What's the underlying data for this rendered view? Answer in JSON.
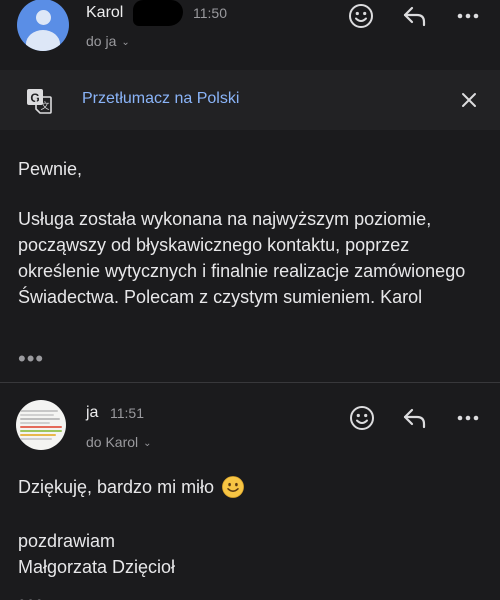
{
  "message1": {
    "sender": "Karol",
    "time": "11:50",
    "recipient": "do ja"
  },
  "translate": {
    "label": "Przetłumacz na Polski"
  },
  "body1": {
    "greeting": "Pewnie,",
    "paragraph": "Usługa została wykonana na najwyższym poziomie, począwszy od błyskawicznego kontaktu, poprzez określenie wytycznych i finalnie realizacje zamówionego Świadectwa. Polecam z czystym sumieniem. Karol",
    "more": "•••"
  },
  "message2": {
    "sender": "ja",
    "time": "11:51",
    "recipient": "do Karol"
  },
  "body2": {
    "thanks": "Dziękuję, bardzo mi miło",
    "regards": "pozdrawiam",
    "signature": "Małgorzata Dzięcioł",
    "more": "•••"
  },
  "icons": {
    "emoji": "emoji-reaction-icon",
    "reply": "reply-icon",
    "more": "more-options-icon",
    "translate": "translate-icon",
    "close": "close-icon"
  },
  "colors": {
    "background": "#1b1b1d",
    "link_blue": "#8ab4f8",
    "avatar_blue": "#5a8ee6"
  }
}
